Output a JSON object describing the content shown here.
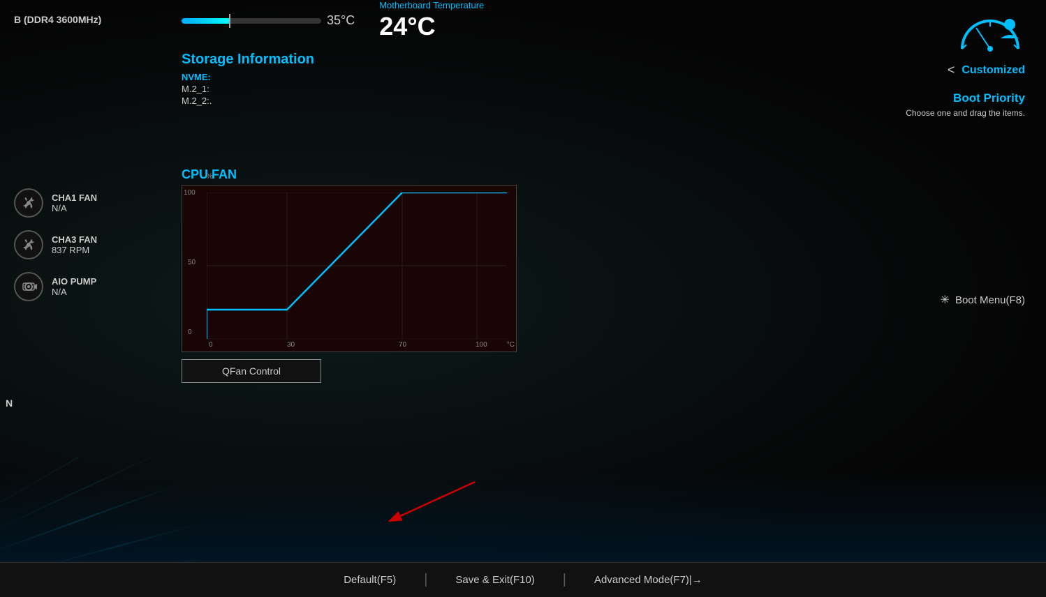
{
  "header": {
    "ram_label": "B (DDR4 3600MHz)",
    "cpu_temp": "35°C",
    "mobo_temp_label": "Motherboard Temperature",
    "mobo_temp_value": "24°C",
    "customized_label": "Customized",
    "chevron": "<"
  },
  "storage": {
    "title": "Storage Information",
    "nvme_label": "NVME:",
    "m2_1_label": "M.2_1:",
    "m2_2_label": "M.2_2:."
  },
  "boot_priority": {
    "title": "Boot Priority",
    "description": "Choose one and drag the items."
  },
  "fans": [
    {
      "name": "CHA1 FAN",
      "speed": "N/A"
    },
    {
      "name": "CHA3 FAN",
      "speed": "837 RPM"
    },
    {
      "name": "AIO PUMP",
      "speed": "N/A"
    }
  ],
  "cpu_fan": {
    "title": "CPU FAN",
    "y_label": "%",
    "x_unit": "°C",
    "y_ticks": [
      "100",
      "50",
      "0"
    ],
    "x_ticks": [
      "0",
      "30",
      "70",
      "100"
    ],
    "qfan_button_label": "QFan Control"
  },
  "bottom_bar": {
    "default_label": "Default(F5)",
    "save_exit_label": "Save & Exit(F10)",
    "advanced_mode_label": "Advanced Mode(F7)|→"
  },
  "boot_menu": {
    "label": "Boot Menu(F8)"
  },
  "n_label": "N"
}
